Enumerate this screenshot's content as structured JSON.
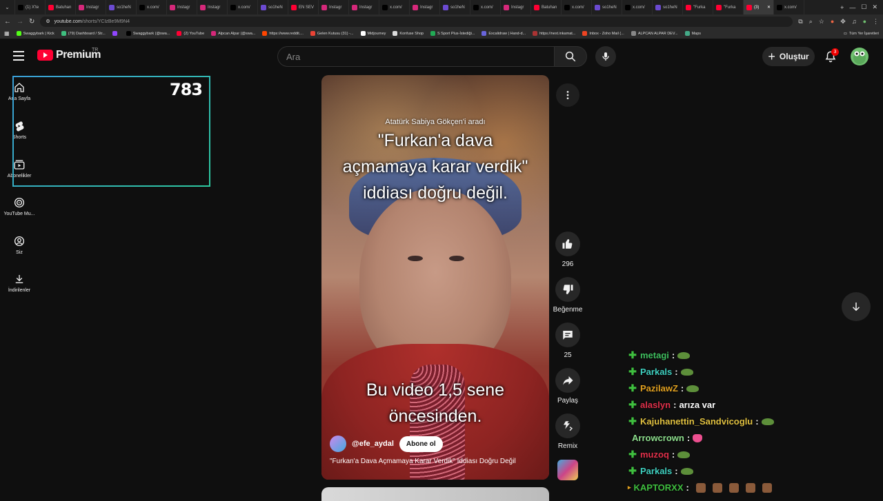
{
  "tabs": [
    {
      "label": "(1) X'te",
      "color": "#000"
    },
    {
      "label": "Batuhan",
      "color": "#ff0033"
    },
    {
      "label": "Instagr",
      "color": "#d6287a"
    },
    {
      "label": "so1heN",
      "color": "#6b4ad0"
    },
    {
      "label": "x.com/",
      "color": "#000"
    },
    {
      "label": "Instagr",
      "color": "#d6287a"
    },
    {
      "label": "Instagr",
      "color": "#d6287a"
    },
    {
      "label": "x.com/",
      "color": "#000"
    },
    {
      "label": "so1heN",
      "color": "#6b4ad0"
    },
    {
      "label": "EN SEV",
      "color": "#ff0033"
    },
    {
      "label": "Instagr",
      "color": "#d6287a"
    },
    {
      "label": "Instagr",
      "color": "#d6287a"
    },
    {
      "label": "x.com/",
      "color": "#000"
    },
    {
      "label": "Instagr",
      "color": "#d6287a"
    },
    {
      "label": "so1heN",
      "color": "#6b4ad0"
    },
    {
      "label": "x.com/",
      "color": "#000"
    },
    {
      "label": "Instagr",
      "color": "#d6287a"
    },
    {
      "label": "Batuhan",
      "color": "#ff0033"
    },
    {
      "label": "x.com/",
      "color": "#000"
    },
    {
      "label": "so1heN",
      "color": "#6b4ad0"
    },
    {
      "label": "x.com/",
      "color": "#000"
    },
    {
      "label": "so1heN",
      "color": "#6b4ad0"
    },
    {
      "label": "\"Furka",
      "color": "#ff0033"
    },
    {
      "label": "\"Furka",
      "color": "#ff0033"
    },
    {
      "label": "(3)",
      "color": "#ff0033",
      "active": true
    },
    {
      "label": "x.com/",
      "color": "#000"
    }
  ],
  "address": {
    "host": "youtube.com",
    "path": "/shorts/YCIzBe9M9N4"
  },
  "bookmarks": [
    {
      "label": "Swaggybark | Kick",
      "color": "#53fc18"
    },
    {
      "label": "(79) Dashboard / Str...",
      "color": "#3fbf7f"
    },
    {
      "label": "",
      "color": "#9146ff"
    },
    {
      "label": "Swaggybark (@swa...",
      "color": "#000"
    },
    {
      "label": "(2) YouTube",
      "color": "#ff0033"
    },
    {
      "label": "Alpcan Alpar (@swa...",
      "color": "#d6287a"
    },
    {
      "label": "https://www.reddit....",
      "color": "#ff4500"
    },
    {
      "label": "Gelen Kutusu (31) -...",
      "color": "#ea4335"
    },
    {
      "label": "Midjourney",
      "color": "#fff"
    },
    {
      "label": "Konfuse Shop",
      "color": "#ddd"
    },
    {
      "label": "S Sport Plus-İstediği...",
      "color": "#2a5"
    },
    {
      "label": "Excalidraw | Hand-d...",
      "color": "#6965db"
    },
    {
      "label": "https://next.inkamat...",
      "color": "#a33"
    },
    {
      "label": "Inbox - Zoho Mail (...",
      "color": "#e42"
    },
    {
      "label": "ALPCAN ALPAR DEV...",
      "color": "#888"
    },
    {
      "label": "Maps",
      "color": "#4a8"
    }
  ],
  "bookmarks_right": "Tüm Yer İşaretleri",
  "header": {
    "logo": "Premium",
    "region": "TR",
    "search_placeholder": "Ara",
    "create_label": "Oluştur",
    "notif_count": "3"
  },
  "sidebar": [
    {
      "label": "Ana Sayfa",
      "icon": "home-icon"
    },
    {
      "label": "Shorts",
      "icon": "shorts-icon"
    },
    {
      "label": "Abonelikler",
      "icon": "subscriptions-icon"
    },
    {
      "label": "YouTube Mu...",
      "icon": "youtube-music-icon"
    },
    {
      "label": "Siz",
      "icon": "you-icon"
    },
    {
      "label": "İndirilenler",
      "icon": "downloads-icon"
    }
  ],
  "overlay": {
    "count": "783"
  },
  "video": {
    "caption_top": "Atatürk Sabiya Gökçen'i aradı",
    "caption_main": "\"Furkan'a dava açmamaya karar verdik\" iddiası doğru değil.",
    "caption_bottom": "Bu video 1,5 sene öncesinden.",
    "channel": "@efe_aydal",
    "subscribe": "Abone ol",
    "title": "\"Furkan'a Dava Açmamaya Karar Verdik\" İddiası Doğru Değil"
  },
  "actions": {
    "likes": "296",
    "dislike": "Beğenme",
    "comments": "25",
    "share": "Paylaş",
    "remix": "Remix"
  },
  "chat": [
    {
      "user": "metagi",
      "color": "#3fbf5f",
      "msg": "",
      "emote": "frog",
      "plus": true
    },
    {
      "user": "Parkals",
      "color": "#3fd0c0",
      "msg": "",
      "emote": "frog",
      "plus": true
    },
    {
      "user": "PazilawZ",
      "color": "#e0a020",
      "msg": "",
      "emote": "frog",
      "plus": true
    },
    {
      "user": "alaslyn",
      "color": "#e0304a",
      "msg": "arıza var",
      "emote": "",
      "plus": true
    },
    {
      "user": "Kajuhanettin_Sandvicoglu",
      "color": "#e0c040",
      "msg": "",
      "emote": "frog",
      "plus": true
    },
    {
      "user": "Arrowcrown",
      "color": "#8ee08e",
      "msg": "",
      "emote": "pink",
      "plus": false
    },
    {
      "user": "muzoq",
      "color": "#e0304a",
      "msg": "",
      "emote": "frog",
      "plus": true
    },
    {
      "user": "Parkals",
      "color": "#3fd0c0",
      "msg": "",
      "emote": "frog",
      "plus": true
    },
    {
      "user": "KAPTORXX",
      "color": "#3fbf3f",
      "msg": "",
      "emote": "multi",
      "plus": false
    }
  ]
}
